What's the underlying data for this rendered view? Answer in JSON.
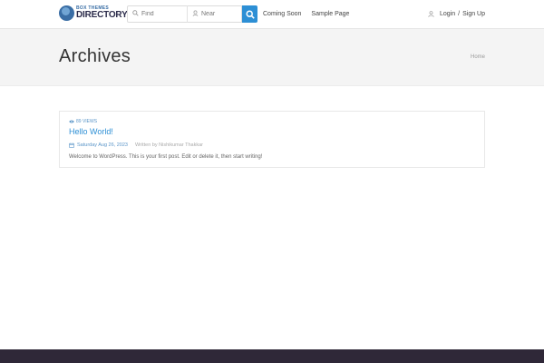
{
  "header": {
    "logo": {
      "small": "BOX THEMES",
      "big": "DIRECTORY"
    },
    "search": {
      "find_placeholder": "Find",
      "near_placeholder": "Near"
    },
    "nav": [
      {
        "label": "Coming Soon"
      },
      {
        "label": "Sample Page"
      }
    ],
    "auth": {
      "login": "Login",
      "separator": "/",
      "signup": "Sign Up"
    }
  },
  "band": {
    "title": "Archives",
    "breadcrumb": "Home"
  },
  "post": {
    "views": "89 VIEWS",
    "title": "Hello World!",
    "date": "Saturday Aug 26, 2023",
    "author": "Written by Nishikumar Thakkar",
    "excerpt": "Welcome to WordPress. This is your first post. Edit or delete it, then start writing!"
  },
  "colors": {
    "accent": "#2d8fd5",
    "footer": "#2f2838",
    "band": "#f4f4f4"
  }
}
